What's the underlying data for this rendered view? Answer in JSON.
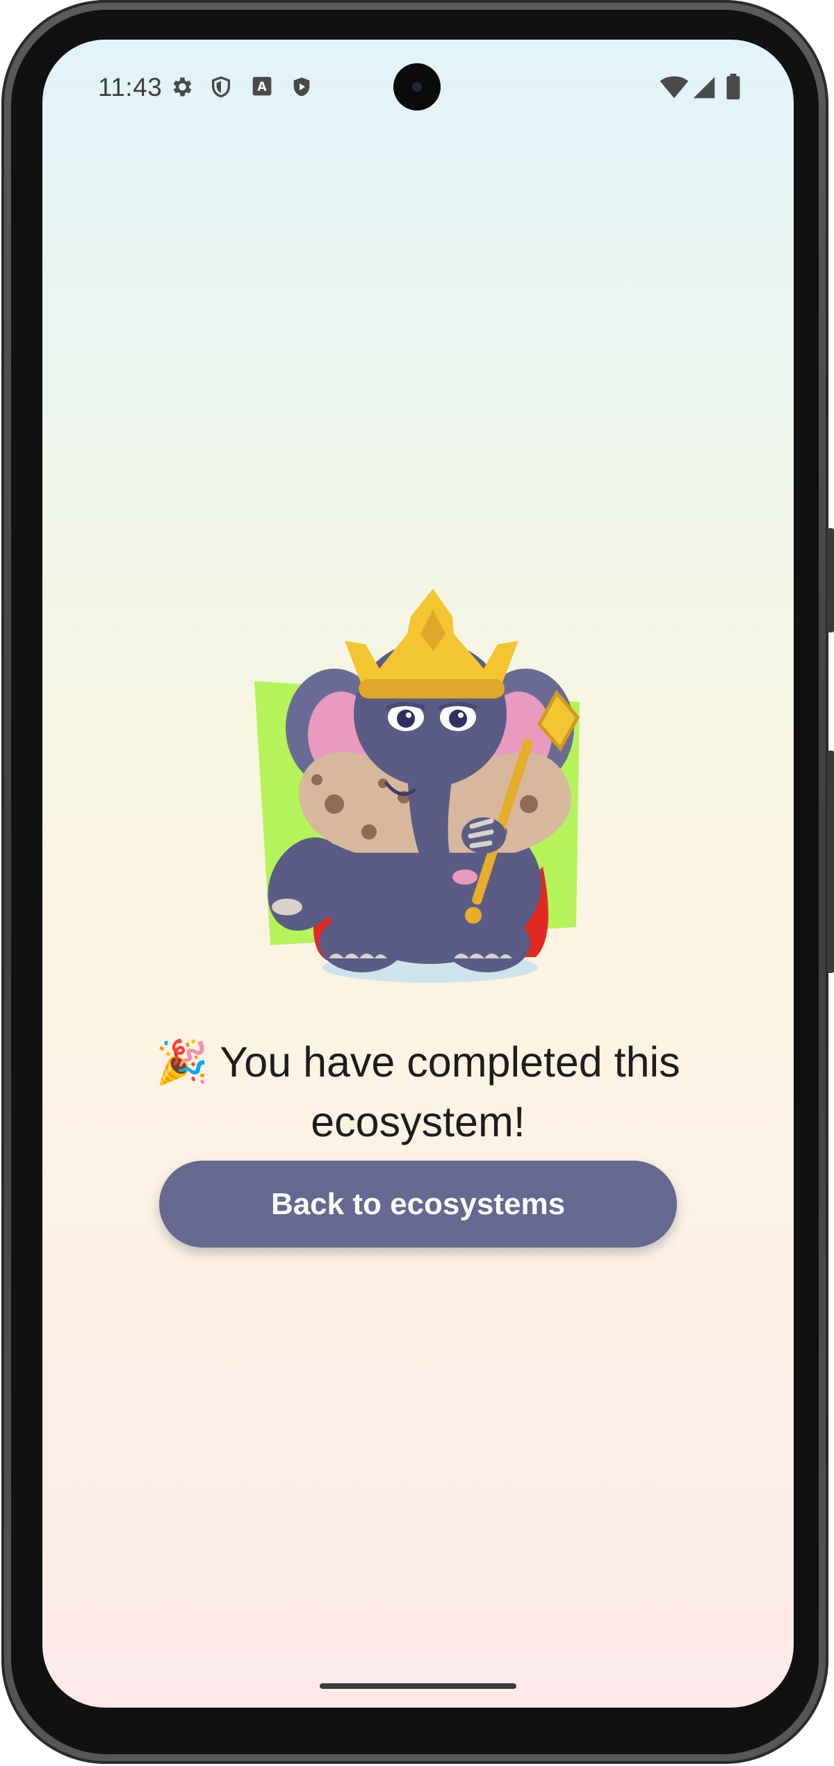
{
  "status_bar": {
    "time": "11:43",
    "left_icons": [
      "gear-icon",
      "shield-icon",
      "font-a-icon",
      "shield-play-icon"
    ],
    "right_icons": [
      "wifi-icon",
      "cellular-signal-icon",
      "battery-icon"
    ]
  },
  "illustration": {
    "subject": "crowned-elephant-mascot",
    "colors": {
      "backdrop": "#b5f35a",
      "body": "#5b5c86",
      "crown": "#f2c531",
      "cape": "#e02a22",
      "ear": "#e89bbf",
      "fur_collar": "#d8b89d"
    }
  },
  "message": {
    "emoji": "🎉",
    "text": "You have completed this ecosystem!"
  },
  "actions": {
    "back_label": "Back to ecosystems",
    "button_color": "#65688f"
  }
}
